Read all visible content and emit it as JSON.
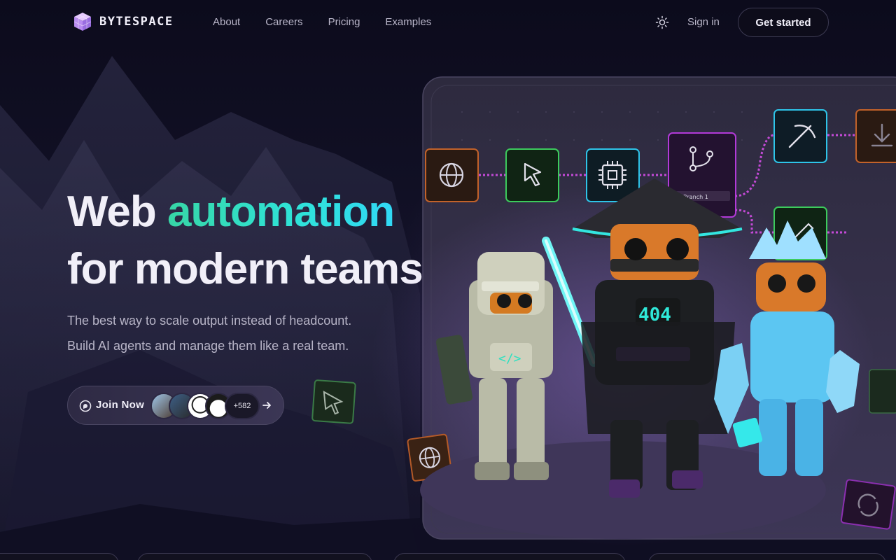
{
  "brand": {
    "name": "BYTESPACE"
  },
  "nav": {
    "links": [
      "About",
      "Careers",
      "Pricing",
      "Examples"
    ],
    "sign_in": "Sign in",
    "cta": "Get started"
  },
  "hero": {
    "title_word": "Web",
    "title_accent": "automation",
    "title_line2": "for modern teams",
    "subtitle_line1": "The best way to scale output instead of headcount.",
    "subtitle_line2": "Build AI agents and manage them like a real team."
  },
  "join": {
    "label": "Join Now",
    "count": "+582"
  },
  "illustration": {
    "robot_badge": "404",
    "node_label": "Branch 1"
  },
  "colors": {
    "accent_start": "#37d6a6",
    "accent_end": "#31d8f5",
    "node_orange": "#c2622a",
    "node_green": "#3ccb5c",
    "node_cyan": "#2ec4e8",
    "node_magenta": "#b23ad8"
  }
}
